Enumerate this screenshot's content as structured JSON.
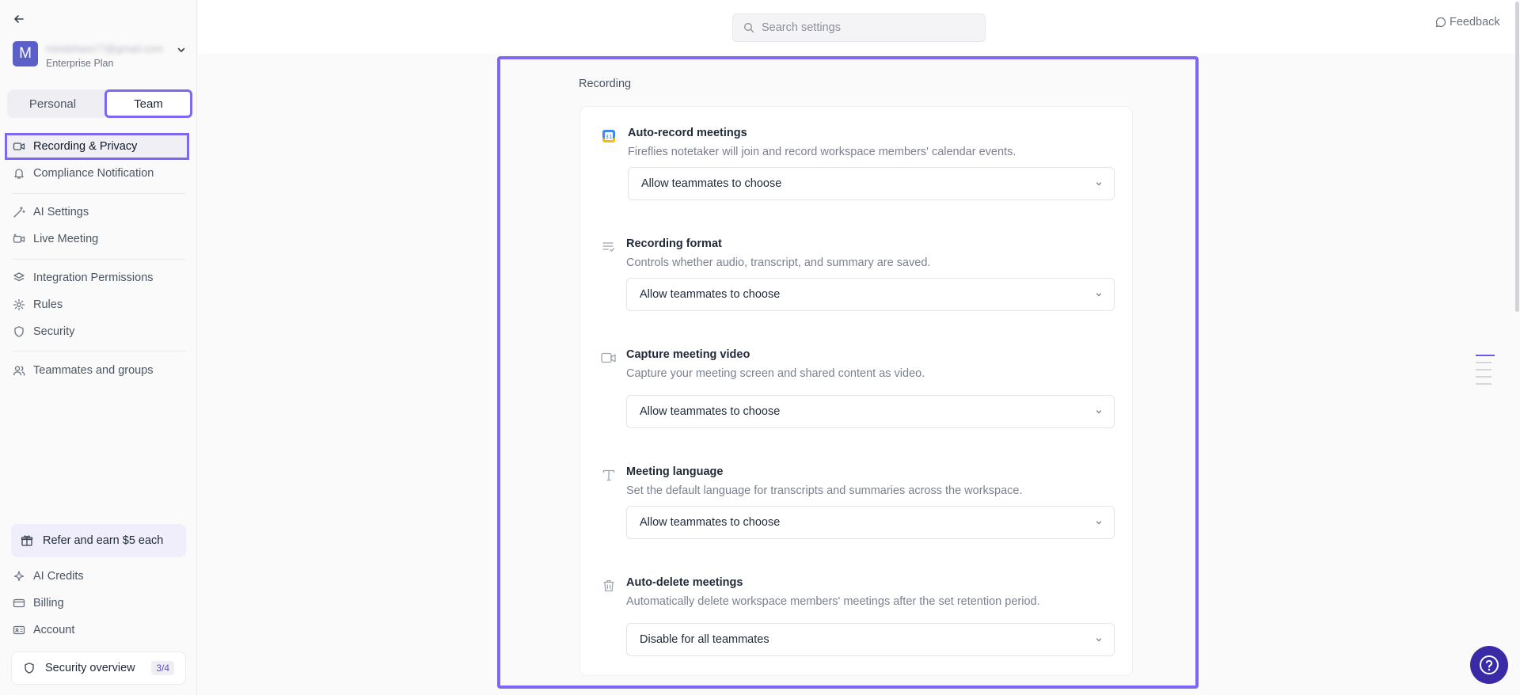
{
  "sidebar": {
    "account": {
      "avatar_letter": "M",
      "email": "mindshare77@gmail.com",
      "plan": "Enterprise Plan"
    },
    "mode_toggle": {
      "personal": "Personal",
      "team": "Team",
      "selected": "Team"
    },
    "nav": [
      {
        "label": "Recording & Privacy",
        "icon": "video-icon",
        "active": true
      },
      {
        "label": "Compliance Notification",
        "icon": "bell-icon"
      },
      {
        "label": "AI Settings",
        "icon": "magic-wand-icon"
      },
      {
        "label": "Live Meeting",
        "icon": "video-plus-icon"
      },
      {
        "label": "Integration Permissions",
        "icon": "layers-icon"
      },
      {
        "label": "Rules",
        "icon": "gear-icon"
      },
      {
        "label": "Security",
        "icon": "shield-icon"
      },
      {
        "label": "Teammates and groups",
        "icon": "users-icon"
      }
    ],
    "refer": {
      "label": "Refer and earn $5 each",
      "icon": "gift-icon"
    },
    "bottom_nav": [
      {
        "label": "AI Credits",
        "icon": "sparkle-icon"
      },
      {
        "label": "Billing",
        "icon": "credit-card-icon"
      },
      {
        "label": "Account",
        "icon": "id-card-icon"
      }
    ],
    "security_overview": {
      "label": "Security overview",
      "badge": "3/4",
      "icon": "shield-icon"
    }
  },
  "topbar": {
    "search_placeholder": "Search settings",
    "feedback_label": "Feedback"
  },
  "main": {
    "section_title": "Recording",
    "settings": [
      {
        "title": "Auto-record meetings",
        "description": "Fireflies notetaker will join and record workspace members' calendar events.",
        "value": "Allow teammates to choose",
        "icon": "calendar-icon"
      },
      {
        "title": "Recording format",
        "description": "Controls whether audio, transcript, and summary are saved.",
        "value": "Allow teammates to choose",
        "icon": "list-check-icon"
      },
      {
        "title": "Capture meeting video",
        "description": "Capture your meeting screen and shared content as video.",
        "value": "Allow teammates to choose",
        "icon": "video-icon"
      },
      {
        "title": "Meeting language",
        "description": "Set the default language for transcripts and summaries across the workspace.",
        "value": "Allow teammates to choose",
        "icon": "text-icon"
      },
      {
        "title": "Auto-delete meetings",
        "description": "Automatically delete workspace members' meetings after the set retention period.",
        "value": "Disable for all teammates",
        "icon": "trash-icon"
      }
    ]
  },
  "colors": {
    "accent": "#7c69ef",
    "avatar": "#5b5fc7",
    "help_fab": "#3b2aa6"
  }
}
